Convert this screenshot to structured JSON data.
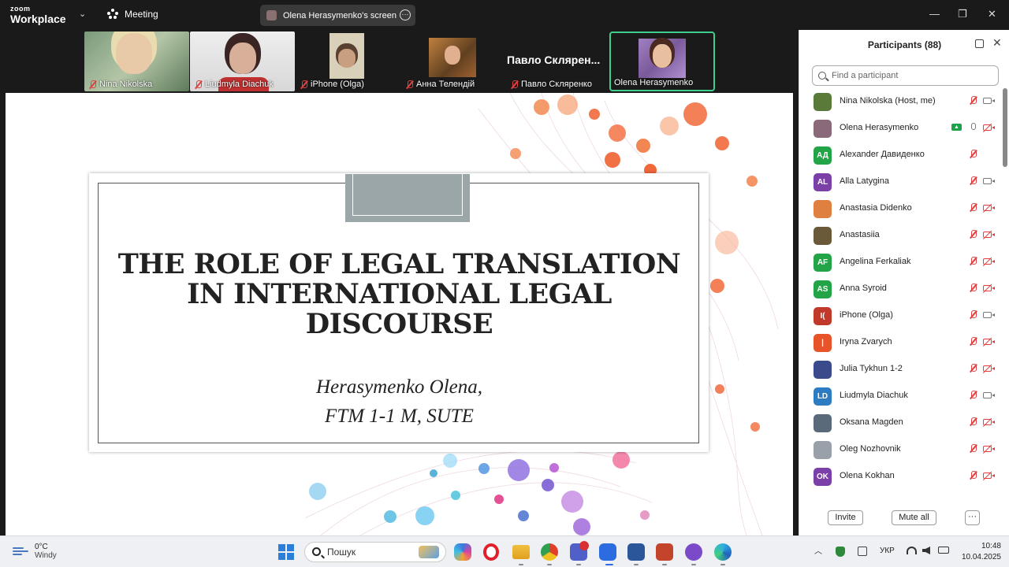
{
  "app": {
    "logo_top": "zoom",
    "logo_bottom": "Workplace",
    "meeting_label": "Meeting",
    "share_title": "Olena Herasymenko's screen",
    "more_glyph": "···",
    "chevron": "⌄",
    "win_min": "—",
    "win_max": "❐",
    "win_close": "✕"
  },
  "video_strip": [
    {
      "name": "Nina Nikolska"
    },
    {
      "name": "Liudmyla Diachuk"
    },
    {
      "name": "iPhone (Olga)"
    },
    {
      "name": "Анна Телендій"
    },
    {
      "name": "Павло Скляренко",
      "big_name": "Павло  Склярен..."
    },
    {
      "name": "Olena Herasymenko"
    }
  ],
  "slide": {
    "title_line1": "THE ROLE OF LEGAL TRANSLATION",
    "title_line2": "IN INTERNATIONAL LEGAL",
    "title_line3": "DISCOURSE",
    "author": "Herasymenko Olena,",
    "group": "FTM 1-1 M, SUTE"
  },
  "participants_panel": {
    "title": "Participants (88)",
    "search_placeholder": "Find a participant",
    "close_glyph": "✕",
    "invite_label": "Invite",
    "mute_all_label": "Mute all",
    "more_label": "···",
    "share_badge": "▲",
    "participants": [
      {
        "name": "Nina Nikolska (Host, me)",
        "initials": "",
        "color": "#5a7a3a",
        "mic": "off",
        "cam": "on"
      },
      {
        "name": "Olena Herasymenko",
        "initials": "",
        "color": "#8a6a7a",
        "mic": "on",
        "cam": "off",
        "sharing": true
      },
      {
        "name": "Alexander Давиденко",
        "initials": "АД",
        "color": "#22a447",
        "mic": "off",
        "cam": "none"
      },
      {
        "name": "Alla Latygina",
        "initials": "AL",
        "color": "#7b3fa8",
        "mic": "off",
        "cam": "on"
      },
      {
        "name": "Anastasia Didenko",
        "initials": "",
        "color": "#e08040",
        "mic": "off",
        "cam": "off"
      },
      {
        "name": "Anastasiia",
        "initials": "",
        "color": "#6a5a3a",
        "mic": "off",
        "cam": "off"
      },
      {
        "name": "Angelina Ferkaliak",
        "initials": "AF",
        "color": "#22a447",
        "mic": "off",
        "cam": "off"
      },
      {
        "name": "Anna Syroid",
        "initials": "AS",
        "color": "#22a447",
        "mic": "off",
        "cam": "off"
      },
      {
        "name": "iPhone (Olga)",
        "initials": "I(",
        "color": "#c0392b",
        "mic": "off",
        "cam": "on"
      },
      {
        "name": "Iryna Zvarych",
        "initials": "|",
        "color": "#e8542a",
        "mic": "off",
        "cam": "off"
      },
      {
        "name": "Julia Tykhun 1-2",
        "initials": "",
        "color": "#3a4a8a",
        "mic": "off",
        "cam": "off"
      },
      {
        "name": "Liudmyla Diachuk",
        "initials": "LD",
        "color": "#2d7bc0",
        "mic": "off",
        "cam": "on"
      },
      {
        "name": "Oksana Magden",
        "initials": "",
        "color": "#5a6a7a",
        "mic": "off",
        "cam": "off"
      },
      {
        "name": "Oleg Nozhovnik",
        "initials": "",
        "color": "#9aa0aa",
        "mic": "off",
        "cam": "off"
      },
      {
        "name": "Olena Kokhan",
        "initials": "OK",
        "color": "#7b3fa8",
        "mic": "off",
        "cam": "off"
      }
    ]
  },
  "taskbar": {
    "temperature": "0°C",
    "weather": "Windy",
    "search_placeholder": "Пошук",
    "language": "УКР",
    "time": "10:48",
    "date": "10.04.2025",
    "chevron_up": "︿"
  }
}
